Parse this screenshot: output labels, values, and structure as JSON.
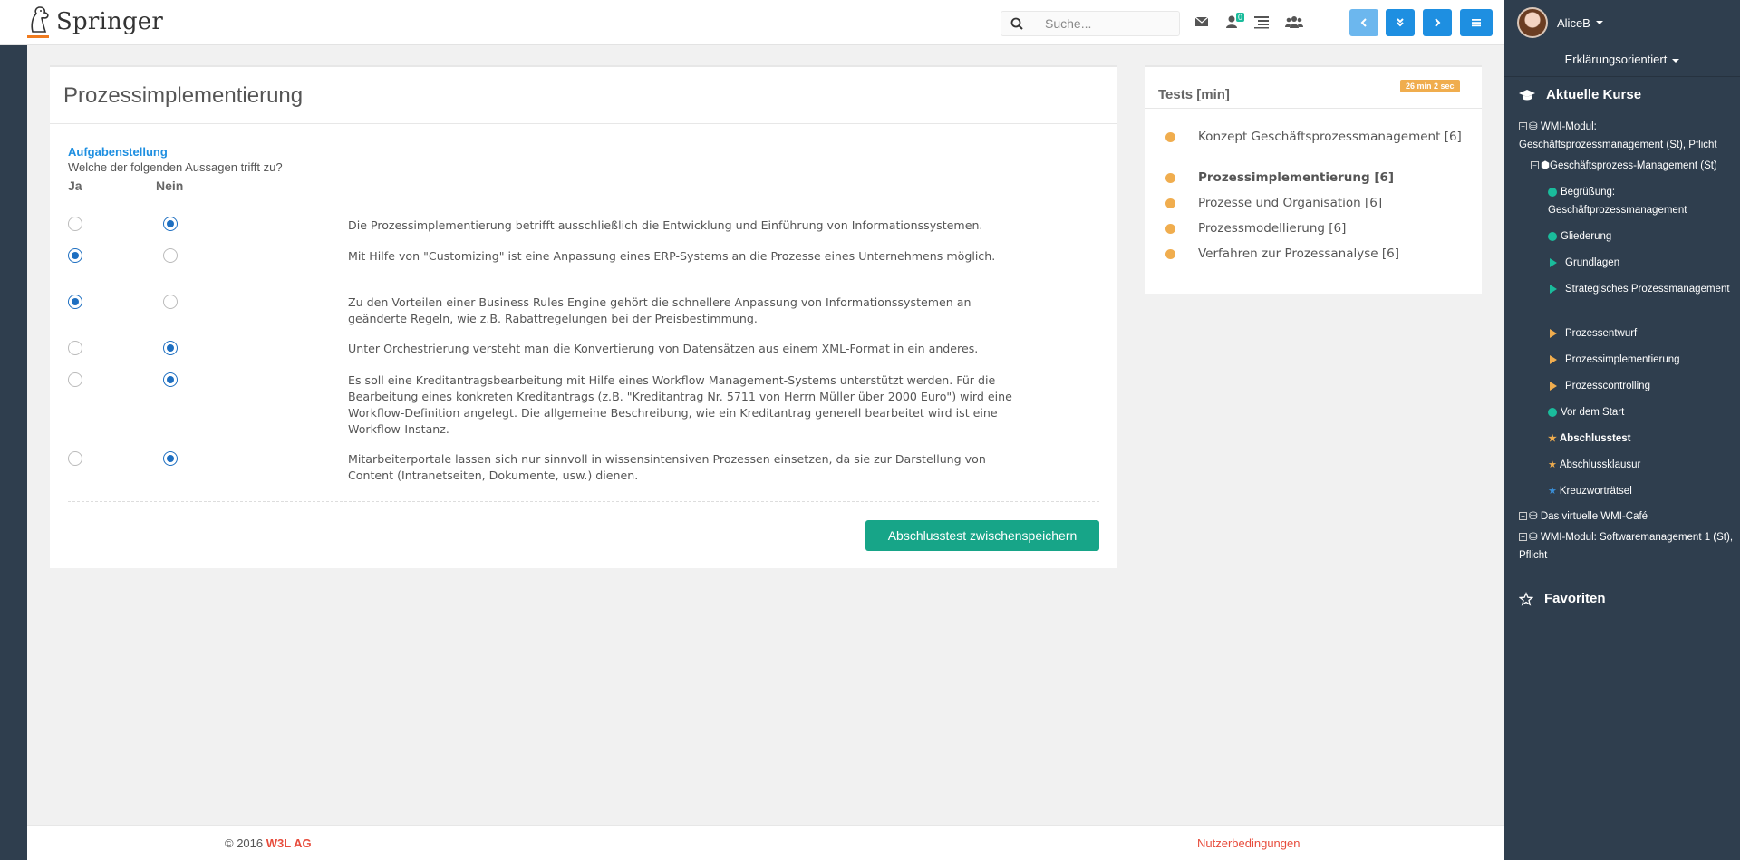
{
  "header": {
    "logo_text": "Springer",
    "search_placeholder": "Suche...",
    "notification_count": "0",
    "icons": [
      "search-icon",
      "envelope-icon",
      "user-notification-icon",
      "list-icon",
      "users-icon"
    ],
    "nav_buttons": [
      "chevron-left-icon",
      "double-chevron-down-icon",
      "chevron-right-icon",
      "menu-icon"
    ]
  },
  "sidebar": {
    "user_name": "AliceB",
    "mode": "Erklärungsorientiert",
    "current_courses_title": "Aktuelle Kurse",
    "course1": "WMI-Modul: Geschäftsprozessmanagement (St), Pflicht",
    "course1_sub": "Geschäftsprozess-Management (St)",
    "items": [
      {
        "label": "Begrüßung: Geschäftprozessmanagement",
        "icon": "dot"
      },
      {
        "label": "Gliederung",
        "icon": "dot"
      },
      {
        "label": "Grundlagen",
        "icon": "play-teal"
      },
      {
        "label": "Strategisches Prozessmanagement",
        "icon": "play-teal"
      },
      {
        "label": "Prozessentwurf",
        "icon": "play-orange"
      },
      {
        "label": "Prozessimplementierung",
        "icon": "play-orange"
      },
      {
        "label": "Prozesscontrolling",
        "icon": "play-orange"
      },
      {
        "label": "Vor dem Start",
        "icon": "dot"
      },
      {
        "label": "Abschlusstest",
        "icon": "star-orange"
      },
      {
        "label": "Abschlussklausur",
        "icon": "star-orange"
      },
      {
        "label": "Kreuzworträtsel",
        "icon": "star-blue"
      }
    ],
    "course2": "Das virtuelle WMI-Café",
    "course3": "WMI-Modul: Softwaremanagement 1 (St), Pflicht",
    "favorites_title": "Favoriten"
  },
  "main": {
    "title": "Prozessimplementierung",
    "task_label": "Aufgabenstellung",
    "task_question": "Welche der folgenden Aussagen trifft zu?",
    "col_yes": "Ja",
    "col_no": "Nein",
    "statements": [
      {
        "text": "Die Prozessimplementierung betrifft ausschließlich die Entwicklung und Einführung von Informationssystemen.",
        "answer": "Nein"
      },
      {
        "text": "Mit Hilfe von \"Customizing\" ist eine Anpassung eines ERP-Systems an die Prozesse eines Unternehmens möglich.",
        "answer": "Ja"
      },
      {
        "text": "Zu den Vorteilen einer Business Rules Engine gehört die schnellere Anpassung von Informationssystemen an geänderte Regeln, wie z.B. Rabattregelungen bei der Preisbestimmung.",
        "answer": "Ja"
      },
      {
        "text": "Unter Orchestrierung versteht man die Konvertierung von Datensätzen aus einem XML-Format in ein anderes.",
        "answer": "Nein"
      },
      {
        "text": "Es soll eine Kreditantragsbearbeitung mit Hilfe eines Workflow Management-Systems unterstützt werden. Für die Bearbeitung eines konkreten Kreditantrags (z.B. \"Kreditantrag Nr. 5711 von Herrn Müller über 2000 Euro\") wird eine Workflow-Definition angelegt. Die allgemeine Beschreibung, wie ein Kreditantrag generell bearbeitet wird ist eine Workflow-Instanz.",
        "answer": "Nein"
      },
      {
        "text": "Mitarbeiterportale lassen sich nur sinnvoll in wissensintensiven Prozessen einsetzen, da sie zur Darstellung von Content (Intranetseiten, Dokumente, usw.) dienen.",
        "answer": "Nein"
      }
    ],
    "save_button": "Abschlusstest zwischenspeichern"
  },
  "tests_panel": {
    "title": "Tests [min]",
    "timer": "26 min 2 sec",
    "items": [
      {
        "label": "Konzept Geschäftsprozessmanagement [6]",
        "active": false
      },
      {
        "label": "Prozessimplementierung [6]",
        "active": true
      },
      {
        "label": "Prozesse und Organisation [6]",
        "active": false
      },
      {
        "label": "Prozessmodellierung [6]",
        "active": false
      },
      {
        "label": "Verfahren zur Prozessanalyse [6]",
        "active": false
      }
    ]
  },
  "footer": {
    "copyright_prefix": "© 2016",
    "company": "W3L AG",
    "terms": "Nutzerbedingungen"
  },
  "colors": {
    "sidebar_bg": "#2f3e4e",
    "accent_blue": "#1e8fe1",
    "save_green": "#17a588",
    "timer_orange": "#f0ad4e",
    "footer_red": "#e74c3c"
  }
}
